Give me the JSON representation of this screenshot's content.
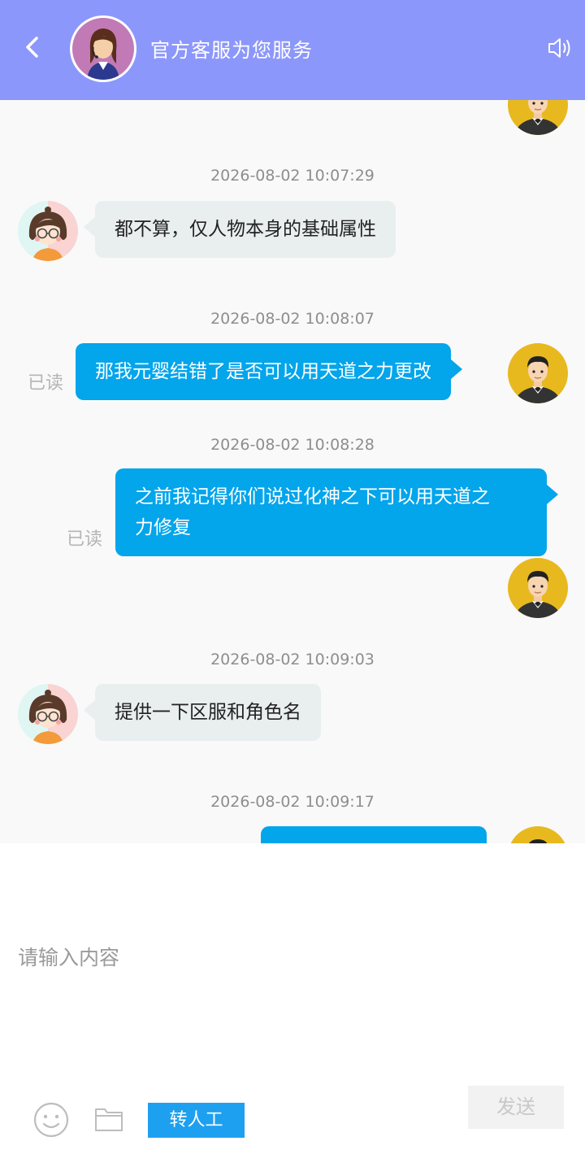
{
  "header": {
    "title": "官方客服为您服务",
    "back_icon": "chevron-left-icon",
    "sound_icon": "speaker-icon",
    "background": "#8c97fb"
  },
  "messages": [
    {
      "time": "2026-08-02 10:07:29",
      "side": "left",
      "text": "都不算，仅人物本身的基础属性"
    },
    {
      "time": "2026-08-02 10:08:07",
      "side": "right",
      "text": "那我元婴结错了是否可以用天道之力更改",
      "status": "已读"
    },
    {
      "time": "2026-08-02 10:08:28",
      "side": "right",
      "text_line1": "之前我记得你们说过化神之下可以用天道之",
      "text_line2": "力修复",
      "status": "已读"
    },
    {
      "time": "2026-08-02 10:09:03",
      "side": "left",
      "text": "提供一下区服和角色名"
    },
    {
      "time": "2026-08-02 10:09:17",
      "side": "right",
      "text": ""
    }
  ],
  "input": {
    "placeholder": "请输入内容",
    "value": ""
  },
  "toolbar": {
    "emoji_icon": "smiley-icon",
    "folder_icon": "folder-icon",
    "transfer_label": "转人工",
    "send_label": "发送"
  },
  "colors": {
    "accent_blue": "#03a5eb",
    "left_bubble": "#e9eeef",
    "transfer_button": "#1ea0f0"
  }
}
